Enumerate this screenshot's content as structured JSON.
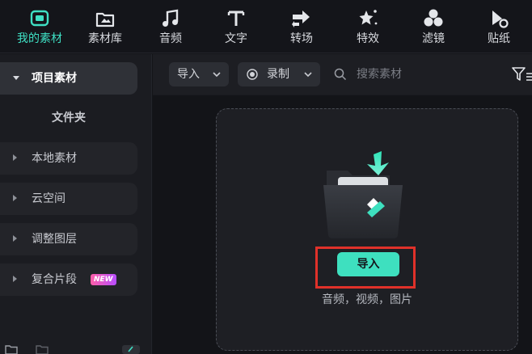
{
  "toolbar": {
    "tabs": [
      {
        "label": "我的素材",
        "icon": "media-icon",
        "active": true
      },
      {
        "label": "素材库",
        "icon": "stock-library-icon",
        "active": false
      },
      {
        "label": "音频",
        "icon": "music-note-icon",
        "active": false
      },
      {
        "label": "文字",
        "icon": "text-icon",
        "active": false
      },
      {
        "label": "转场",
        "icon": "transition-icon",
        "active": false
      },
      {
        "label": "特效",
        "icon": "sparkle-effects-icon",
        "active": false
      },
      {
        "label": "滤镜",
        "icon": "filter-circles-icon",
        "active": false
      },
      {
        "label": "贴纸",
        "icon": "sticker-icon",
        "active": false
      }
    ],
    "accent_color": "#3fe0c4"
  },
  "sidebar": {
    "project_media": "项目素材",
    "folder": "文件夹",
    "local_media": "本地素材",
    "cloud": "云空间",
    "adjustment_layer": "调整图层",
    "compound_clip": "复合片段",
    "new_badge": "NEW"
  },
  "filterbar": {
    "import_label": "导入",
    "record_label": "录制",
    "search_placeholder": "搜索素材"
  },
  "dropzone": {
    "import_button": "导入",
    "hint": "音频，视频，图片",
    "button_color": "#3ee0bf",
    "highlight_color": "#e0312a"
  }
}
